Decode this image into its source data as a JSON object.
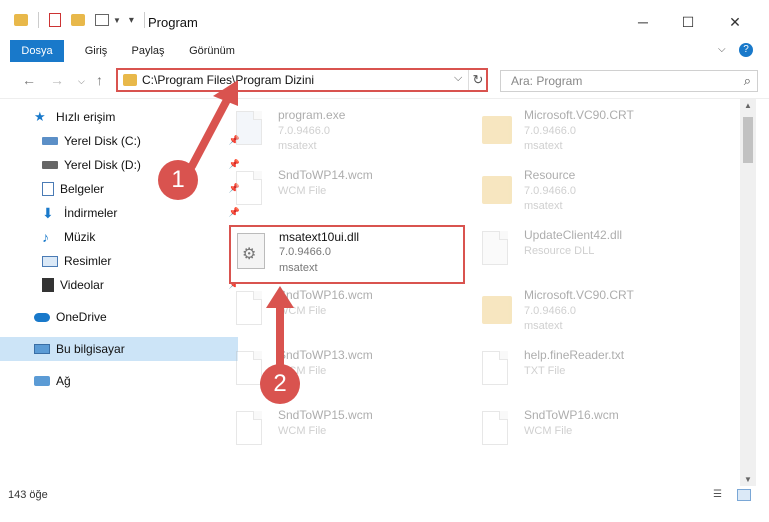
{
  "window": {
    "title": "Program",
    "minimize_label": "─",
    "maximize_label": "☐",
    "close_label": "✕"
  },
  "ribbon": {
    "tabs": [
      {
        "label": "Dosya",
        "active": true
      },
      {
        "label": "Giriş",
        "active": false
      },
      {
        "label": "Paylaş",
        "active": false
      },
      {
        "label": "Görünüm",
        "active": false
      }
    ],
    "expand_icon": "chevron-down-icon",
    "help_label": "?"
  },
  "address": {
    "path": "C:\\Program Files\\Program Dizini",
    "dropdown_label": "⌵",
    "refresh_label": "↻"
  },
  "search": {
    "placeholder": "Ara: Program"
  },
  "sidebar": {
    "items": [
      {
        "label": "Hızlı erişim",
        "icon": "star-icon",
        "pinned": false
      },
      {
        "label": "Yerel Disk (C:)",
        "icon": "drive-icon",
        "pinned": true
      },
      {
        "label": "Yerel Disk (D:)",
        "icon": "drive-icon",
        "pinned": true
      },
      {
        "label": "Belgeler",
        "icon": "documents-icon",
        "pinned": true
      },
      {
        "label": "İndirmeler",
        "icon": "download-icon",
        "pinned": true
      },
      {
        "label": "Müzik",
        "icon": "music-icon",
        "pinned": true
      },
      {
        "label": "Resimler",
        "icon": "pictures-icon",
        "pinned": true
      },
      {
        "label": "Videolar",
        "icon": "video-icon",
        "pinned": true
      },
      {
        "label": "OneDrive",
        "icon": "cloud-icon",
        "pinned": false
      },
      {
        "label": "Bu bilgisayar",
        "icon": "computer-icon",
        "pinned": false,
        "selected": true
      },
      {
        "label": "Ağ",
        "icon": "network-icon",
        "pinned": false
      }
    ]
  },
  "files": [
    {
      "name": "program.exe",
      "line2": "7.0.9466.0",
      "line3": "msatext",
      "icon": "exe-icon"
    },
    {
      "name": "Microsoft.VC90.CRT",
      "line2": "7.0.9466.0",
      "line3": "msatext",
      "icon": "folder-icon"
    },
    {
      "name": "SndToWP14.wcm",
      "line2": "WCM File",
      "line3": "",
      "icon": "file-icon"
    },
    {
      "name": "Resource",
      "line2": "7.0.9466.0",
      "line3": "msatext",
      "icon": "folder-icon"
    },
    {
      "name": "msatext10ui.dll",
      "line2": "7.0.9466.0",
      "line3": "msatext",
      "icon": "dll-gear-icon"
    },
    {
      "name": "UpdateClient42.dll",
      "line2": "Resource DLL",
      "line3": "",
      "icon": "dll-gear-icon"
    },
    {
      "name": "SndToWP16.wcm",
      "line2": "WCM File",
      "line3": "",
      "icon": "file-icon"
    },
    {
      "name": "Microsoft.VC90.CRT",
      "line2": "7.0.9466.0",
      "line3": "msatext",
      "icon": "folder-icon"
    },
    {
      "name": "SndToWP13.wcm",
      "line2": "WCM File",
      "line3": "",
      "icon": "file-icon"
    },
    {
      "name": "help.fineReader.txt",
      "line2": "TXT File",
      "line3": "",
      "icon": "file-icon"
    },
    {
      "name": "SndToWP15.wcm",
      "line2": "WCM File",
      "line3": "",
      "icon": "file-icon"
    },
    {
      "name": "SndToWP16.wcm",
      "line2": "WCM File",
      "line3": "",
      "icon": "file-icon"
    }
  ],
  "annotations": {
    "badge1": "1",
    "badge2": "2",
    "color": "#d9534f"
  },
  "status": {
    "count": "143 öğe"
  },
  "colors": {
    "accent": "#1979ca",
    "selection": "#cce4f7",
    "folder": "#e8b84a"
  }
}
